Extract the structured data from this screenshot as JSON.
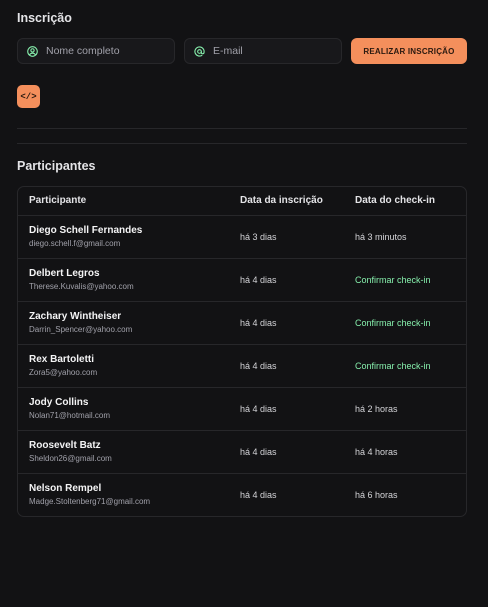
{
  "registration": {
    "title": "Inscrição",
    "name_placeholder": "Nome completo",
    "email_placeholder": "E-mail",
    "submit_label": "REALIZAR INSCRIÇÃO",
    "code_button_label": "</>"
  },
  "participants": {
    "title": "Participantes",
    "columns": [
      "Participante",
      "Data da inscrição",
      "Data do check-in"
    ],
    "rows": [
      {
        "name": "Diego Schell Fernandes",
        "email": "diego.schell.f@gmail.com",
        "registered": "há 3 dias",
        "checkin": "há 3 minutos",
        "checkin_is_action": false
      },
      {
        "name": "Delbert Legros",
        "email": "Therese.Kuvalis@yahoo.com",
        "registered": "há 4 dias",
        "checkin": "Confirmar check-in",
        "checkin_is_action": true
      },
      {
        "name": "Zachary Wintheiser",
        "email": "Darrin_Spencer@yahoo.com",
        "registered": "há 4 dias",
        "checkin": "Confirmar check-in",
        "checkin_is_action": true
      },
      {
        "name": "Rex Bartoletti",
        "email": "Zora5@yahoo.com",
        "registered": "há 4 dias",
        "checkin": "Confirmar check-in",
        "checkin_is_action": true
      },
      {
        "name": "Jody Collins",
        "email": "Nolan71@hotmail.com",
        "registered": "há 4 dias",
        "checkin": "há 2 horas",
        "checkin_is_action": false
      },
      {
        "name": "Roosevelt Batz",
        "email": "Sheldon26@gmail.com",
        "registered": "há 4 dias",
        "checkin": "há 4 horas",
        "checkin_is_action": false
      },
      {
        "name": "Nelson Rempel",
        "email": "Madge.Stoltenberg71@gmail.com",
        "registered": "há 4 dias",
        "checkin": "há 6 horas",
        "checkin_is_action": false
      }
    ]
  },
  "colors": {
    "accent": "#f48f5c",
    "checkin_action": "#86efac",
    "icon_green": "#86efac"
  }
}
